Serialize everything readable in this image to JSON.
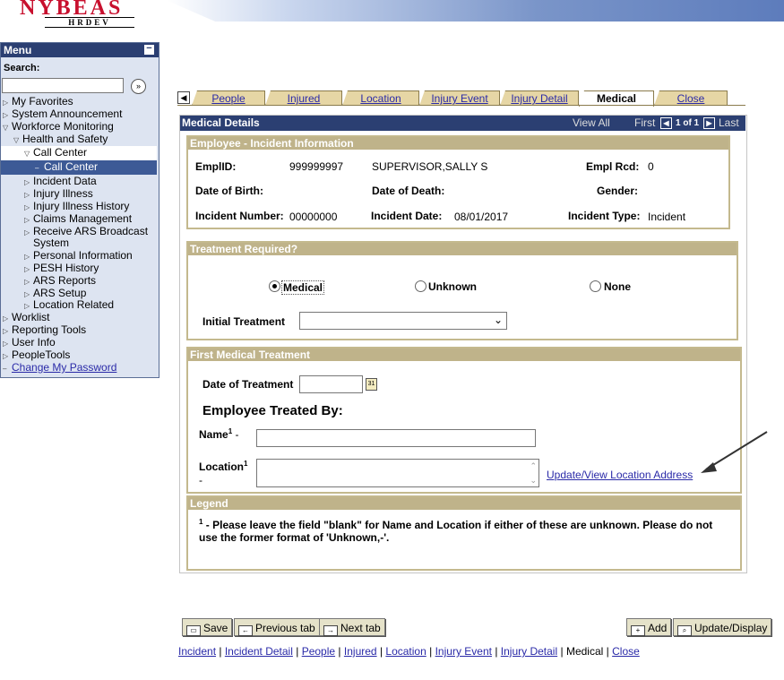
{
  "header": {
    "logo": "NYBEAS",
    "logo_sub": "HRDEV"
  },
  "menu": {
    "title": "Menu",
    "search_label": "Search:",
    "items": [
      {
        "label": "My Favorites"
      },
      {
        "label": "System Announcement"
      },
      {
        "label": "Workforce Monitoring"
      },
      {
        "label": "Health and Safety"
      },
      {
        "label": "Call Center"
      },
      {
        "label": "Call Center"
      },
      {
        "label": "Incident Data"
      },
      {
        "label": "Injury Illness"
      },
      {
        "label": "Injury Illness History"
      },
      {
        "label": "Claims Management"
      },
      {
        "label": "Receive ARS Broadcast"
      },
      {
        "label": "System"
      },
      {
        "label": "Personal Information"
      },
      {
        "label": "PESH History"
      },
      {
        "label": "ARS Reports"
      },
      {
        "label": "ARS Setup"
      },
      {
        "label": "Location Related"
      },
      {
        "label": "Worklist"
      },
      {
        "label": "Reporting Tools"
      },
      {
        "label": "User Info"
      },
      {
        "label": "PeopleTools"
      },
      {
        "label": "Change My Password"
      }
    ]
  },
  "tabs": [
    {
      "label": "People"
    },
    {
      "label": "Injured"
    },
    {
      "label": "Location"
    },
    {
      "label": "Injury Event"
    },
    {
      "label": "Injury Detail"
    },
    {
      "label": "Medical"
    },
    {
      "label": "Close"
    }
  ],
  "panel": {
    "title": "Medical Details",
    "view_all": "View All",
    "first": "First",
    "count": "1 of 1",
    "last": "Last"
  },
  "employee": {
    "title": "Employee - Incident Information",
    "emplid_label": "EmplID:",
    "emplid": "999999997",
    "name": "SUPERVISOR,SALLY S",
    "rcd_label": "Empl Rcd:",
    "rcd": "0",
    "dob_label": "Date of Birth:",
    "dod_label": "Date of Death:",
    "gender_label": "Gender:",
    "incnum_label": "Incident Number:",
    "incnum": "00000000",
    "incdate_label": "Incident Date:",
    "incdate": "08/01/2017",
    "inctype_label": "Incident Type:",
    "inctype": "Incident"
  },
  "treatment": {
    "title": "Treatment Required?",
    "opt_medical": "Medical",
    "opt_unknown": "Unknown",
    "opt_none": "None",
    "initial_label": "Initial Treatment",
    "initial_value": ""
  },
  "first_medical": {
    "title": "First Medical Treatment",
    "date_label": "Date of Treatment",
    "date_value": "",
    "treated_by": "Employee Treated By:",
    "name_label": "Name",
    "location_label": "Location",
    "sup": "1",
    "dash": "-",
    "update_link": "Update/View Location Address"
  },
  "legend": {
    "title": "Legend",
    "sup": "1",
    "text": " - Please leave the field \"blank\" for Name and Location if either of these are unknown. Please do not use the former format of 'Unknown,-'."
  },
  "buttons": {
    "save": "Save",
    "prev": "Previous tab",
    "next": "Next tab",
    "add": "Add",
    "update": "Update/Display"
  },
  "bottom_links": [
    "Incident",
    "Incident Detail",
    "People",
    "Injured",
    "Location",
    "Injury Event",
    "Injury Detail",
    "Medical",
    "Close"
  ],
  "separator": "|"
}
